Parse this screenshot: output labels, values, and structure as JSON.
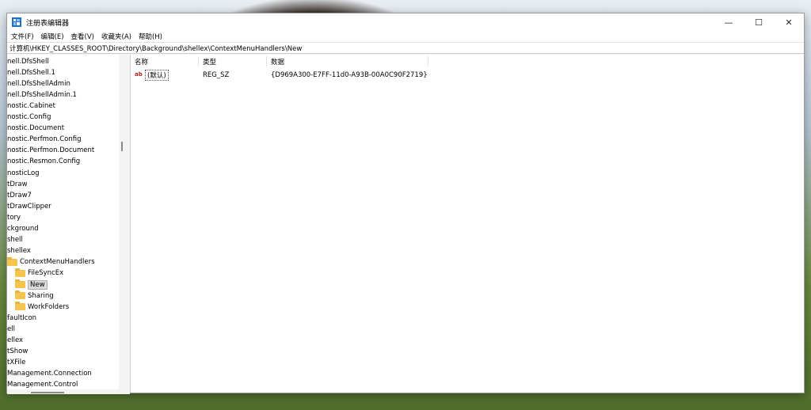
{
  "window": {
    "title": "注册表编辑器",
    "controls": {
      "minimize": "—",
      "maximize": "☐",
      "close": "✕"
    }
  },
  "menu": [
    "文件(F)",
    "编辑(E)",
    "查看(V)",
    "收藏夹(A)",
    "帮助(H)"
  ],
  "address": "计算机\\HKEY_CLASSES_ROOT\\Directory\\Background\\shellex\\ContextMenuHandlers\\New",
  "tree": {
    "items": [
      {
        "label": "nell.DfsShell",
        "folder": false
      },
      {
        "label": "nell.DfsShell.1",
        "folder": false
      },
      {
        "label": "nell.DfsShellAdmin",
        "folder": false
      },
      {
        "label": "nell.DfsShellAdmin.1",
        "folder": false
      },
      {
        "label": "nostic.Cabinet",
        "folder": false
      },
      {
        "label": "nostic.Config",
        "folder": false
      },
      {
        "label": "nostic.Document",
        "folder": false
      },
      {
        "label": "nostic.Perfmon.Config",
        "folder": false
      },
      {
        "label": "nostic.Perfmon.Document",
        "folder": false
      },
      {
        "label": "nostic.Resmon.Config",
        "folder": false
      },
      {
        "label": "nosticLog",
        "folder": false
      },
      {
        "label": "tDraw",
        "folder": false
      },
      {
        "label": "tDraw7",
        "folder": false
      },
      {
        "label": "tDrawClipper",
        "folder": false
      },
      {
        "label": "tory",
        "folder": false
      },
      {
        "label": "ckground",
        "folder": false
      },
      {
        "label": "shell",
        "folder": false
      },
      {
        "label": "shellex",
        "folder": false
      },
      {
        "label": "ContextMenuHandlers",
        "folder": true
      },
      {
        "label": "FileSyncEx",
        "folder": true
      },
      {
        "label": "New",
        "folder": true,
        "selected": true
      },
      {
        "label": "Sharing",
        "folder": true
      },
      {
        "label": "WorkFolders",
        "folder": true
      },
      {
        "label": "faultIcon",
        "folder": false
      },
      {
        "label": "ell",
        "folder": false
      },
      {
        "label": "ellex",
        "folder": false
      },
      {
        "label": "tShow",
        "folder": false
      },
      {
        "label": "tXFile",
        "folder": false
      },
      {
        "label": "Management.Connection",
        "folder": false
      },
      {
        "label": "Management.Control",
        "folder": false
      }
    ]
  },
  "values": {
    "columns": {
      "name": "名称",
      "type": "类型",
      "data": "数据"
    },
    "rows": [
      {
        "icon": "ab",
        "name": "(默认)",
        "type": "REG_SZ",
        "data": "{D969A300-E7FF-11d0-A93B-00A0C90F2719}"
      }
    ]
  }
}
